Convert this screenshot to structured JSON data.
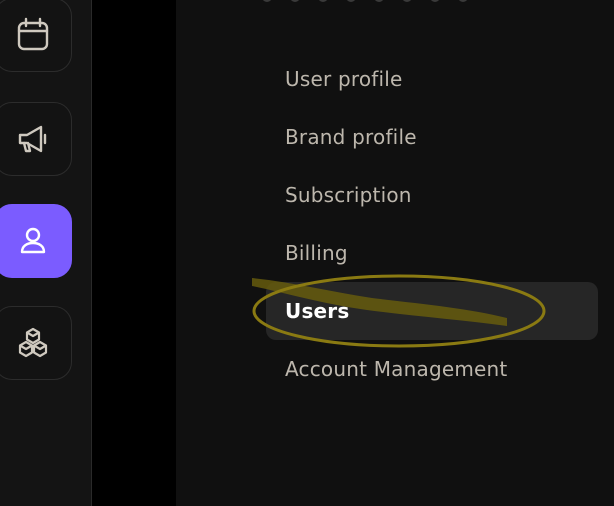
{
  "rail": {
    "items": [
      {
        "icon": "calendar-icon",
        "active": false
      },
      {
        "icon": "megaphone-icon",
        "active": false
      },
      {
        "icon": "user-icon",
        "active": true
      },
      {
        "icon": "cubes-icon",
        "active": false
      }
    ]
  },
  "settings_menu": {
    "items": [
      {
        "label": "User profile",
        "active": false
      },
      {
        "label": "Brand profile",
        "active": false
      },
      {
        "label": "Subscription",
        "active": false
      },
      {
        "label": "Billing",
        "active": false
      },
      {
        "label": "Users",
        "active": true
      },
      {
        "label": "Account Management",
        "active": false
      }
    ]
  },
  "colors": {
    "accent": "#7b5cff",
    "highlight_marker": "#8a7a12"
  }
}
